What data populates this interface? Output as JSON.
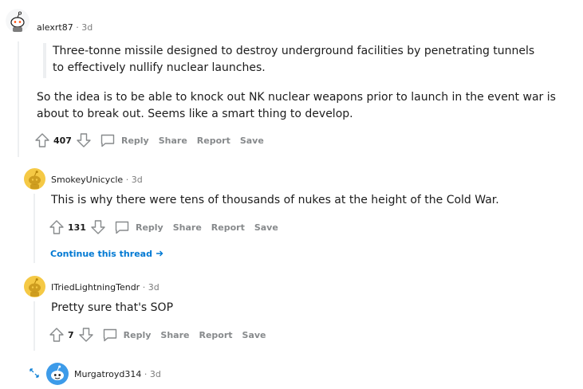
{
  "comments": [
    {
      "username": "alexrt87",
      "age": "3d",
      "quote": "Three-tonne missile designed to destroy underground facilities by penetrating tunnels to effectively nullify nuclear launches.",
      "body": "So the idea is to be able to knock out NK nuclear weapons prior to launch in the event war is about to break out. Seems like a smart thing to develop.",
      "score": "407",
      "actions": {
        "reply": "Reply",
        "share": "Share",
        "report": "Report",
        "save": "Save"
      }
    },
    {
      "username": "SmokeyUnicycle",
      "age": "3d",
      "body": "This is why there were tens of thousands of nukes at the height of the Cold War.",
      "score": "131",
      "actions": {
        "reply": "Reply",
        "share": "Share",
        "report": "Report",
        "save": "Save"
      },
      "continue_label": "Continue this thread"
    },
    {
      "username": "ITriedLightningTendr",
      "age": "3d",
      "body": "Pretty sure that's SOP",
      "score": "7",
      "actions": {
        "reply": "Reply",
        "share": "Share",
        "report": "Report",
        "save": "Save"
      }
    },
    {
      "username": "Murgatroyd314",
      "age": "3d"
    }
  ],
  "colors": {
    "avatar_yellow": "#f5c945",
    "avatar_blue": "#3d9be9",
    "link_blue": "#0079d3",
    "muted": "#878a8c"
  },
  "icons": [
    "upvote-icon",
    "downvote-icon",
    "reply-icon",
    "expand-icon",
    "arrow-right-icon"
  ]
}
